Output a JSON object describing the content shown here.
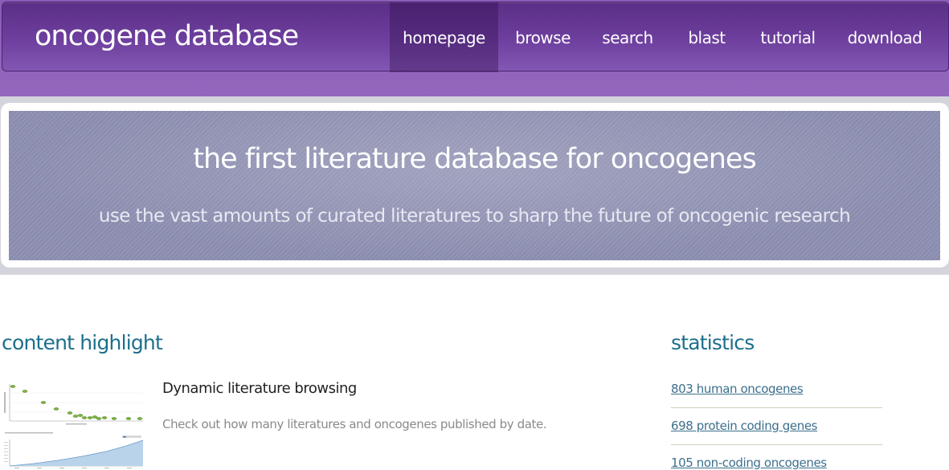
{
  "header": {
    "brand": "oncogene database",
    "nav": [
      "homepage",
      "browse",
      "search",
      "blast",
      "tutorial",
      "download"
    ],
    "active_nav": "homepage"
  },
  "hero": {
    "title": "the first literature database for oncogenes",
    "subtitle": "use the vast amounts of curated literatures to sharp the future of oncogenic research"
  },
  "content_highlight": {
    "heading": "content highlight",
    "feature_title": "Dynamic literature browsing",
    "feature_desc": "Check out how many literatures and oncogenes published by date."
  },
  "statistics": {
    "heading": "statistics",
    "links": [
      "803 human oncogenes",
      "698 protein coding genes",
      "105 non-coding oncogenes"
    ]
  },
  "colors": {
    "header_purple": "#6e3f9e",
    "hero_blue_grey": "#8d8fb2",
    "section_teal": "#1d6f8c",
    "link_blue": "#3c6f8c"
  }
}
